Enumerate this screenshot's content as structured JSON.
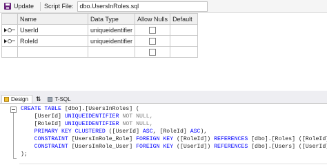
{
  "toolbar": {
    "update_label": "Update",
    "script_file_label": "Script File:",
    "script_file_value": "dbo.UsersInRoles.sql"
  },
  "grid": {
    "headers": [
      "Name",
      "Data Type",
      "Allow Nulls",
      "Default"
    ],
    "rows": [
      {
        "name": "UserId",
        "type": "uniqueidentifier",
        "primary_key": true,
        "allow_nulls": false,
        "default": ""
      },
      {
        "name": "RoleId",
        "type": "uniqueidentifier",
        "primary_key": true,
        "allow_nulls": false,
        "default": ""
      },
      {
        "name": "",
        "type": "",
        "primary_key": false,
        "allow_nulls": false,
        "default": ""
      }
    ]
  },
  "tabs": {
    "design": "Design",
    "swap": "⇅",
    "tsql": "T-SQL"
  },
  "sql": {
    "l1_kw": "CREATE TABLE",
    "l1_rest": " [dbo].[UsersInRoles] (",
    "l2_col": "    [UserId] ",
    "l2_type": "UNIQUEIDENTIFIER",
    "l2_nn": " NOT NULL,",
    "l3_col": "    [RoleId] ",
    "l3_type": "UNIQUEIDENTIFIER",
    "l3_nn": " NOT NULL,",
    "l4_kw": "    PRIMARY KEY CLUSTERED",
    "l4_p1": " ([UserId] ",
    "l4_asc1": "ASC",
    "l4_p2": ", [RoleId] ",
    "l4_asc2": "ASC",
    "l4_p3": "),",
    "l5_kw1": "    CONSTRAINT",
    "l5_name": " [UsersInRole_Role] ",
    "l5_kw2": "FOREIGN KEY",
    "l5_p1": " ([RoleId]) ",
    "l5_kw3": "REFERENCES",
    "l5_p2": " [dbo].[Roles] ([RoleId]),",
    "l6_kw1": "    CONSTRAINT",
    "l6_name": " [UsersInRole_User] ",
    "l6_kw2": "FOREIGN KEY",
    "l6_p1": " ([UserId]) ",
    "l6_kw3": "REFERENCES",
    "l6_p2": " [dbo].[Users] ([UserId])",
    "l7": ");"
  }
}
